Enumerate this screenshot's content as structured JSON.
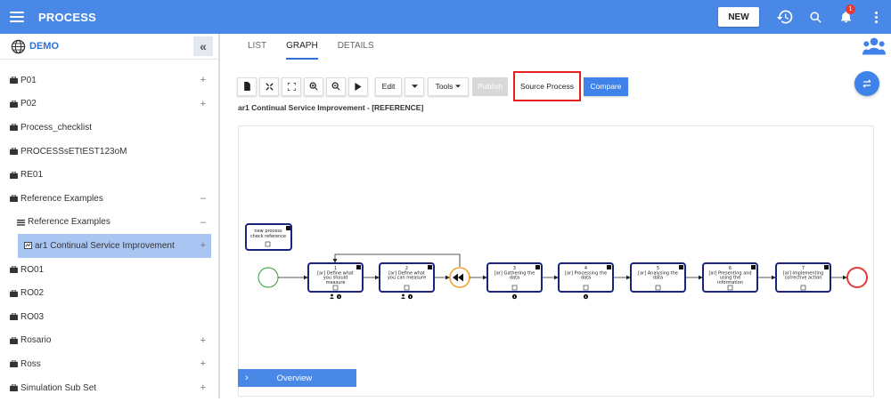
{
  "header": {
    "title": "PROCESS",
    "new_label": "NEW",
    "notification_count": "1",
    "accent_color": "#4a88e8"
  },
  "sidebar": {
    "workspace": "DEMO",
    "items": [
      {
        "label": "P01",
        "control": "+",
        "icon": "briefcase-icon"
      },
      {
        "label": "P02",
        "control": "+",
        "icon": "briefcase-icon"
      },
      {
        "label": "Process_checklist",
        "control": "",
        "icon": "briefcase-icon"
      },
      {
        "label": "PROCESSsETtEST123oM",
        "control": "",
        "icon": "briefcase-icon"
      },
      {
        "label": "RE01",
        "control": "",
        "icon": "briefcase-icon"
      },
      {
        "label": "Reference Examples",
        "control": "–",
        "icon": "briefcase-icon"
      },
      {
        "label": "Reference Examples",
        "control": "–",
        "icon": "list-icon"
      },
      {
        "label": "ar1 Continual Service Improvement",
        "control": "+",
        "icon": "process-icon"
      },
      {
        "label": "RO01",
        "control": "",
        "icon": "briefcase-icon"
      },
      {
        "label": "RO02",
        "control": "",
        "icon": "briefcase-icon"
      },
      {
        "label": "RO03",
        "control": "",
        "icon": "briefcase-icon"
      },
      {
        "label": "Rosario",
        "control": "+",
        "icon": "briefcase-icon"
      },
      {
        "label": "Ross",
        "control": "+",
        "icon": "briefcase-icon"
      },
      {
        "label": "Simulation Sub Set",
        "control": "+",
        "icon": "briefcase-icon"
      }
    ]
  },
  "main": {
    "tabs": [
      {
        "label": "LIST",
        "active": false
      },
      {
        "label": "GRAPH",
        "active": true
      },
      {
        "label": "DETAILS",
        "active": false
      }
    ],
    "toolbar": {
      "edit_label": "Edit",
      "tools_label": "Tools",
      "publish_label": "Publish",
      "source_label": "Source Process",
      "compare_label": "Compare"
    },
    "process_title": "ar1 Continual Service Improvement - [REFERENCE]",
    "overview_label": "Overview"
  },
  "diagram": {
    "note_line1": "new process",
    "note_line2": "check reference",
    "tasks": [
      {
        "num": "1",
        "lines": [
          "[ar] Define what",
          "you should",
          "measure"
        ]
      },
      {
        "num": "2",
        "lines": [
          "[ar] Define what",
          "you can measure"
        ]
      },
      {
        "num": "3",
        "lines": [
          "[ar] Gathering the",
          "data"
        ]
      },
      {
        "num": "4",
        "lines": [
          "[ar] Processing the",
          "data"
        ]
      },
      {
        "num": "5",
        "lines": [
          "[ar] Analysing the",
          "data"
        ]
      },
      {
        "num": "6",
        "lines": [
          "[ar] Presenting and",
          "using the",
          "information"
        ]
      },
      {
        "num": "7",
        "lines": [
          "[ar] Implementing",
          "corrective action"
        ]
      }
    ],
    "task_border_color": "#1a237e",
    "start_color": "#4caf50",
    "end_color": "#e53935",
    "gateway_color": "#f0a030"
  }
}
